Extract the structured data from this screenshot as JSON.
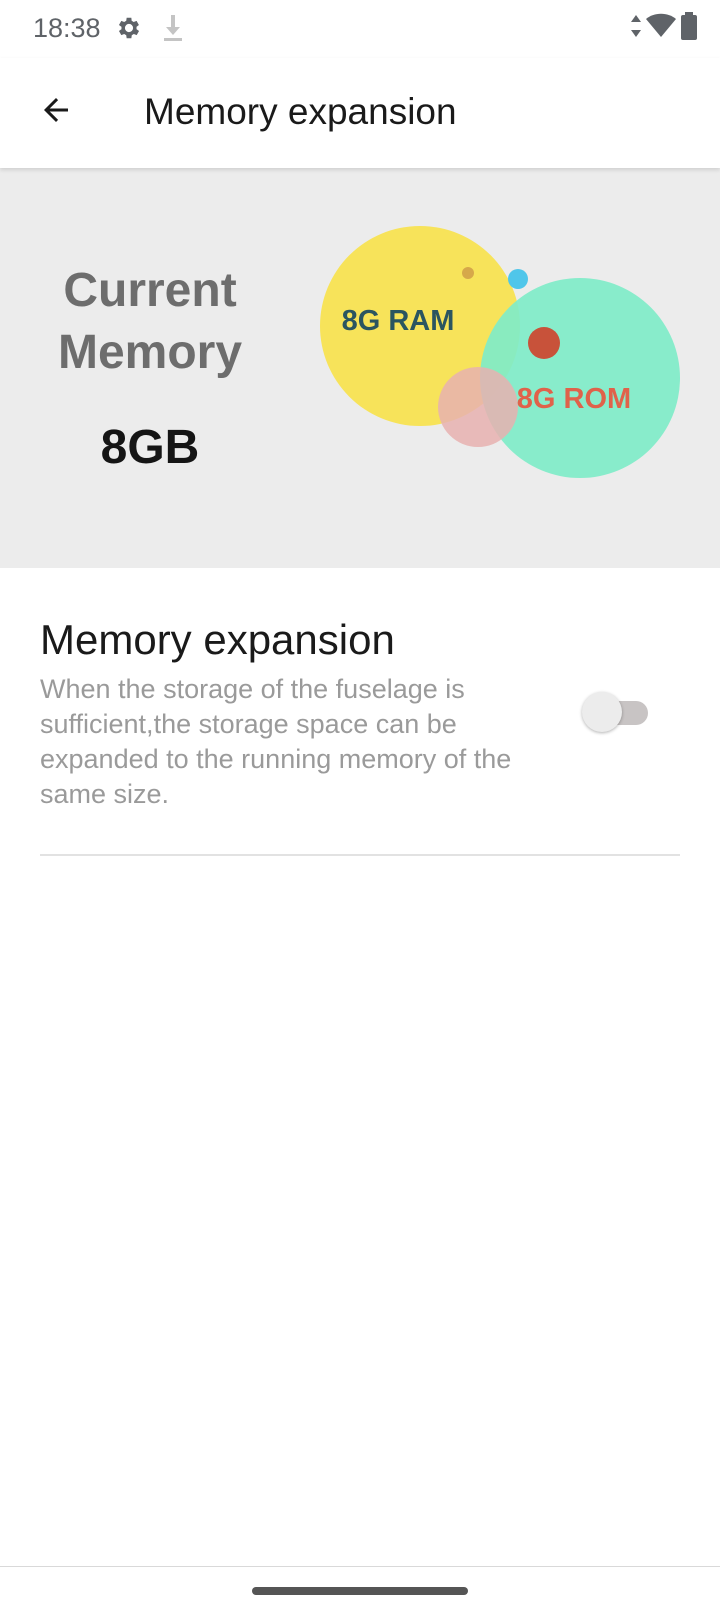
{
  "status_bar": {
    "time": "18:38",
    "icons": [
      "gear-icon",
      "download-icon",
      "data-arrows-icon",
      "wifi-icon",
      "battery-icon"
    ]
  },
  "app_bar": {
    "title": "Memory expansion",
    "back_icon": "arrow-back-icon"
  },
  "hero": {
    "title_line1": "Current",
    "title_line2": "Memory",
    "size": "8GB",
    "ram_label": "8G RAM",
    "rom_label": "8G ROM",
    "colors": {
      "background": "#ececec",
      "ram_circle": "#f7e35a",
      "rom_circle": "#7fecc8",
      "ram_text": "#2b5560",
      "rom_text": "#e0624a",
      "dot_blue": "#4fc6ea",
      "dot_red": "#c8523a",
      "dot_pink": "#e8b1b0"
    }
  },
  "setting": {
    "title": "Memory expansion",
    "description": "When the storage of the fuselage is sufficient,the storage space can be expanded to the running memory of the same size.",
    "toggle_on": false
  }
}
